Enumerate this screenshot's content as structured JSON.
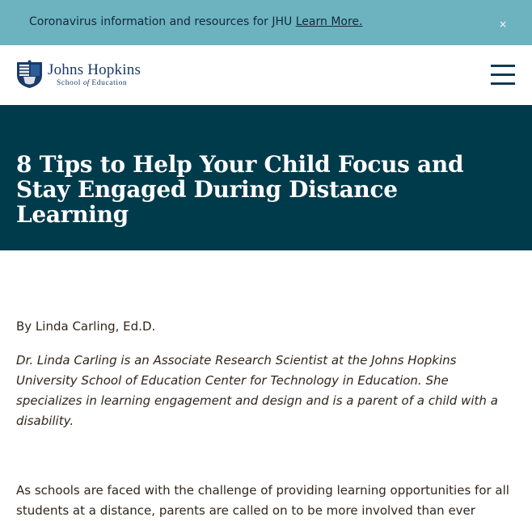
{
  "alert": {
    "message": "Coronavirus information and resources for JHU ",
    "link_label": "Learn More.",
    "close_label": "×"
  },
  "header": {
    "logo_name": "Johns Hopkins",
    "logo_sub_school": "School",
    "logo_sub_of": "of",
    "logo_sub_education": "Education",
    "menu_icon": "hamburger-menu-icon"
  },
  "hero": {
    "title": "8 Tips to Help Your Child Focus and Stay Engaged During Distance Learning"
  },
  "article": {
    "byline": "By Linda Carling, Ed.D.",
    "author_bio": "Dr. Linda Carling is an Associate Research Scientist at the Johns Hopkins University School of Education Center for Technology in Education. She specializes in learning engagement and design and is a parent of a child with a disability.",
    "intro": "As schools are faced with the challenge of providing learning opportunities for all students at a distance, parents are called on to be more involved than ever"
  },
  "colors": {
    "alert_bg": "#6db3bf",
    "hero_bg": "#003b4b",
    "brand_blue": "#1a3a6b",
    "body_text": "#31261d"
  }
}
